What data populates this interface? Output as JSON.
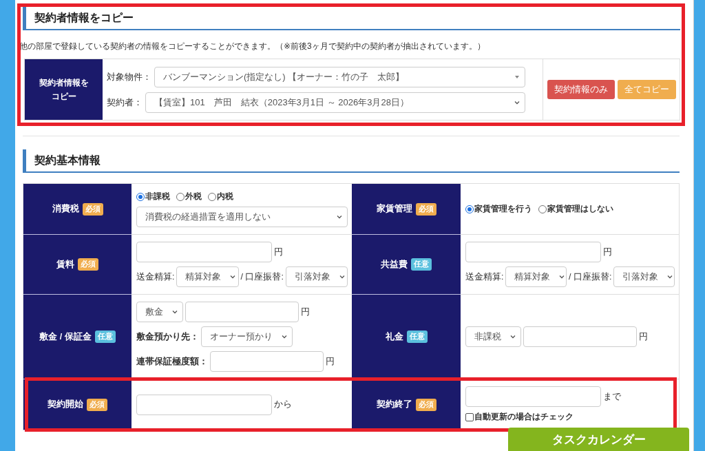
{
  "copy_section": {
    "highlighted": true,
    "title": "契約者情報をコピー",
    "description": "他の部屋で登録している契約者の情報をコピーすることができます。（※前後3ヶ月で契約中の契約者が抽出されています。）",
    "label": "契約者情報をコピー",
    "fields": [
      {
        "label": "対象物件：",
        "value": "バンブーマンション(指定なし) 【オーナー：竹の子　太郎】",
        "kind": "combo"
      },
      {
        "label": "契約者：",
        "value": "【賃室】101　芦田　結衣（2023年3月1日 ～ 2026年3月28日）",
        "kind": "select"
      }
    ],
    "buttons": [
      {
        "label": "契約情報のみ",
        "kind": "danger"
      },
      {
        "label": "全てコピー",
        "kind": "warning"
      }
    ]
  },
  "basic_section": {
    "title": "契約基本情報",
    "rows": [
      {
        "highlighted": false,
        "cells": [
          {
            "label": "消費税",
            "badge": {
              "text": "必須",
              "kind": "required"
            },
            "lines": [
              [
                {
                  "kind": "radio",
                  "label": "非課税",
                  "selected": true
                },
                {
                  "kind": "radio",
                  "label": "外税",
                  "selected": false
                },
                {
                  "kind": "radio",
                  "label": "内税",
                  "selected": false
                }
              ],
              [
                {
                  "kind": "select",
                  "value": "消費税の経過措置を適用しない"
                }
              ]
            ]
          },
          {
            "label": "家賃管理",
            "badge": {
              "text": "必須",
              "kind": "required"
            },
            "lines": [
              [
                {
                  "kind": "radio",
                  "label": "家賃管理を行う",
                  "selected": true
                },
                {
                  "kind": "radio",
                  "label": "家賃管理はしない",
                  "selected": false
                }
              ]
            ]
          }
        ]
      },
      {
        "highlighted": false,
        "cells": [
          {
            "label": "賃料",
            "badge": {
              "text": "必須",
              "kind": "required"
            },
            "lines": [
              [
                {
                  "kind": "input"
                },
                {
                  "kind": "unit",
                  "text": "円"
                }
              ],
              [
                {
                  "kind": "text",
                  "text": "送金精算:"
                },
                {
                  "kind": "select",
                  "value": "精算対象"
                },
                {
                  "kind": "text",
                  "text": "/ 口座振替:"
                },
                {
                  "kind": "select",
                  "value": "引落対象"
                }
              ]
            ]
          },
          {
            "label": "共益費",
            "badge": {
              "text": "任意",
              "kind": "optional"
            },
            "lines": [
              [
                {
                  "kind": "input"
                },
                {
                  "kind": "unit",
                  "text": "円"
                }
              ],
              [
                {
                  "kind": "text",
                  "text": "送金精算:"
                },
                {
                  "kind": "select",
                  "value": "精算対象"
                },
                {
                  "kind": "text",
                  "text": "/ 口座振替:"
                },
                {
                  "kind": "select",
                  "value": "引落対象"
                }
              ]
            ]
          }
        ]
      },
      {
        "highlighted": false,
        "cells": [
          {
            "label": "敷金 / 保証金",
            "badge": {
              "text": "任意",
              "kind": "optional"
            },
            "lines": [
              [
                {
                  "kind": "select",
                  "value": "敷金"
                },
                {
                  "kind": "input"
                },
                {
                  "kind": "unit",
                  "text": "円"
                }
              ],
              [
                {
                  "kind": "strong",
                  "text": "敷金預かり先："
                },
                {
                  "kind": "select",
                  "value": "オーナー預かり"
                }
              ],
              [
                {
                  "kind": "strong",
                  "text": "連帯保証極度額："
                },
                {
                  "kind": "input"
                },
                {
                  "kind": "unit",
                  "text": "円"
                }
              ]
            ]
          },
          {
            "label": "礼金",
            "badge": {
              "text": "任意",
              "kind": "optional"
            },
            "lines": [
              [
                {
                  "kind": "select",
                  "value": "非課税"
                },
                {
                  "kind": "input"
                },
                {
                  "kind": "unit",
                  "text": "円"
                }
              ]
            ]
          }
        ]
      },
      {
        "highlighted": true,
        "cells": [
          {
            "label": "契約開始",
            "badge": {
              "text": "必須",
              "kind": "required"
            },
            "lines": [
              [
                {
                  "kind": "input"
                },
                {
                  "kind": "unit",
                  "text": "から"
                }
              ]
            ]
          },
          {
            "label": "契約終了",
            "badge": {
              "text": "必須",
              "kind": "required"
            },
            "lines": [
              [
                {
                  "kind": "input"
                },
                {
                  "kind": "unit",
                  "text": "まで"
                }
              ],
              [
                {
                  "kind": "checkbox",
                  "label": "自動更新の場合はチェック",
                  "checked": false
                }
              ]
            ]
          }
        ]
      }
    ]
  },
  "task_button": {
    "label": "タスクカレンダー"
  }
}
